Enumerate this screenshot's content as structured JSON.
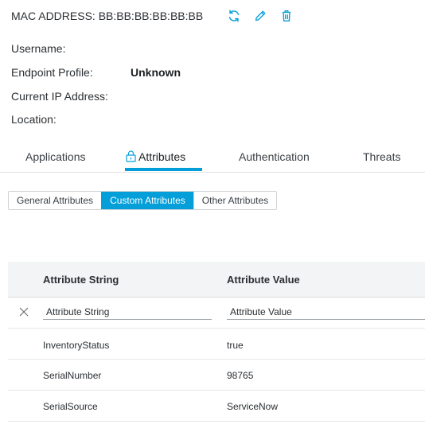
{
  "header": {
    "mac_label": "MAC ADDRESS: BB:BB:BB:BB:BB:BB",
    "accent_color": "#049fd9",
    "icons": [
      "refresh-icon",
      "edit-icon",
      "delete-icon"
    ]
  },
  "info": {
    "username_label": "Username:",
    "endpoint_profile_label": "Endpoint Profile:",
    "endpoint_profile_value": "Unknown",
    "current_ip_label": "Current IP Address:",
    "location_label": "Location:"
  },
  "tabs": [
    {
      "label": "Applications",
      "active": false
    },
    {
      "label": "Attributes",
      "active": true,
      "icon": "lock-icon"
    },
    {
      "label": "Authentication",
      "active": false
    },
    {
      "label": "Threats",
      "active": false
    }
  ],
  "segments": [
    {
      "label": "General Attributes",
      "selected": false
    },
    {
      "label": "Custom Attributes",
      "selected": true
    },
    {
      "label": "Other Attributes",
      "selected": false
    }
  ],
  "table": {
    "columns": [
      "Attribute String",
      "Attribute Value"
    ],
    "filters": {
      "string_placeholder": "Attribute String",
      "value_placeholder": "Attribute Value"
    },
    "rows": [
      [
        "InventoryStatus",
        "true"
      ],
      [
        "SerialNumber",
        "98765"
      ],
      [
        "SerialSource",
        "ServiceNow"
      ]
    ]
  }
}
